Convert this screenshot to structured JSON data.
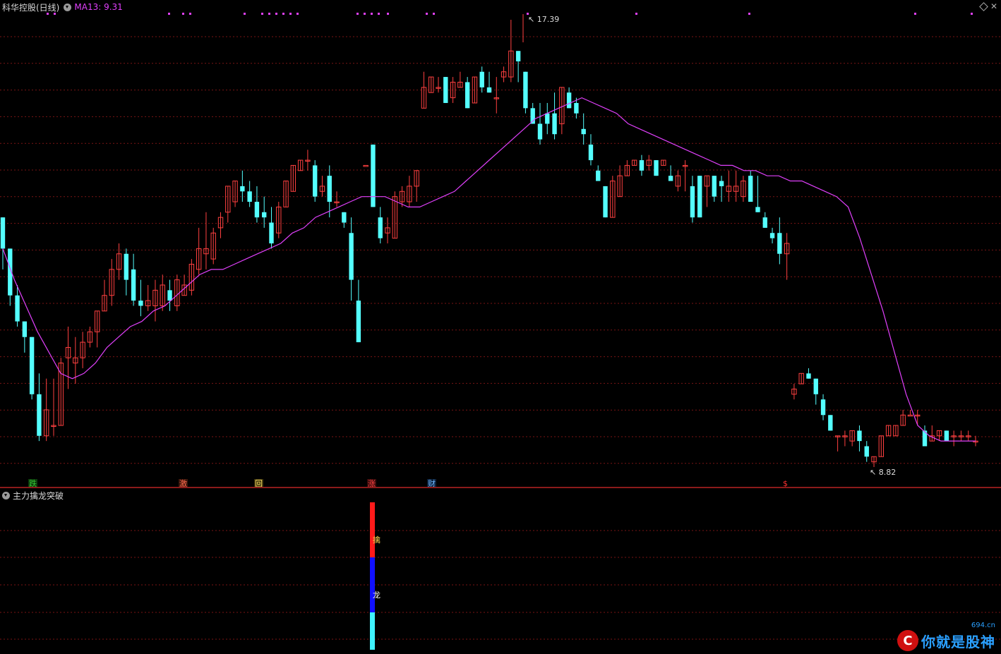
{
  "header": {
    "title": "科华控股(日线)",
    "ma_label": "MA13: 9.31"
  },
  "price_labels": {
    "high": "17.39",
    "low": "8.82"
  },
  "markers": [
    {
      "text": "跌",
      "color": "#35c535",
      "bg": "#0b3a0b"
    },
    {
      "text": "激",
      "color": "#ff6a4d",
      "bg": "#3a150b"
    },
    {
      "text": "回",
      "color": "#ffe066",
      "bg": "#3a320b"
    },
    {
      "text": "涨",
      "color": "#ff4444",
      "bg": "#3a0b0b"
    },
    {
      "text": "财",
      "color": "#6fb7ff",
      "bg": "#0b203a"
    },
    {
      "text": "$",
      "color": "#ff3030",
      "bg": "#000000"
    }
  ],
  "indicator": {
    "title": "主力擒龙突破",
    "bar_labels": [
      "擒",
      "龙"
    ]
  },
  "watermark": {
    "logo": "C",
    "text": "你就是股神",
    "site": "694.cn"
  },
  "colors": {
    "up": "#ff4040",
    "down": "#54ffff",
    "ma": "#e040fb",
    "grid": "#7a1414",
    "dot": "#e040fb"
  },
  "chart_data": {
    "type": "candlestick",
    "title": "科华控股(日线)",
    "ma_period": 13,
    "ma_last": 9.31,
    "y_high": 17.39,
    "y_low": 8.82,
    "candles": [
      [
        13.6,
        13.6,
        12.6,
        13.0
      ],
      [
        13.0,
        13.0,
        11.9,
        12.1
      ],
      [
        12.1,
        12.3,
        11.5,
        11.6
      ],
      [
        11.6,
        11.6,
        11.0,
        11.3
      ],
      [
        11.3,
        11.2,
        10.1,
        10.2
      ],
      [
        10.2,
        10.6,
        9.3,
        9.4
      ],
      [
        9.4,
        10.5,
        9.3,
        9.9
      ],
      [
        9.6,
        10.5,
        9.4,
        9.6
      ],
      [
        9.6,
        10.9,
        9.6,
        10.8
      ],
      [
        10.9,
        11.5,
        10.3,
        11.1
      ],
      [
        10.8,
        11.3,
        10.4,
        10.9
      ],
      [
        10.9,
        11.4,
        10.7,
        11.2
      ],
      [
        11.2,
        11.5,
        11.1,
        11.4
      ],
      [
        11.4,
        11.8,
        11.1,
        11.8
      ],
      [
        11.8,
        12.4,
        11.8,
        12.1
      ],
      [
        12.1,
        12.8,
        11.9,
        12.6
      ],
      [
        12.6,
        13.1,
        12.4,
        12.9
      ],
      [
        12.9,
        13.0,
        12.1,
        12.4
      ],
      [
        12.6,
        12.9,
        11.9,
        12.0
      ],
      [
        12.0,
        12.4,
        11.7,
        11.9
      ],
      [
        11.9,
        12.3,
        11.8,
        12.0
      ],
      [
        11.9,
        12.4,
        11.6,
        12.2
      ],
      [
        11.9,
        12.5,
        11.8,
        12.3
      ],
      [
        12.2,
        12.4,
        11.8,
        12.0
      ],
      [
        11.9,
        12.5,
        11.8,
        12.4
      ],
      [
        12.1,
        12.5,
        12.1,
        12.3
      ],
      [
        12.2,
        12.8,
        12.1,
        12.7
      ],
      [
        12.6,
        13.4,
        12.5,
        13.0
      ],
      [
        12.9,
        13.7,
        12.6,
        13.0
      ],
      [
        12.8,
        13.4,
        12.7,
        13.3
      ],
      [
        13.4,
        13.7,
        13.2,
        13.6
      ],
      [
        13.7,
        14.1,
        13.5,
        14.2
      ],
      [
        13.9,
        14.3,
        13.8,
        14.3
      ],
      [
        14.2,
        14.5,
        13.9,
        14.1
      ],
      [
        14.1,
        14.3,
        13.8,
        13.9
      ],
      [
        13.9,
        14.2,
        13.5,
        13.6
      ],
      [
        13.7,
        14.0,
        13.4,
        13.6
      ],
      [
        13.5,
        13.8,
        13.0,
        13.1
      ],
      [
        13.3,
        13.9,
        13.2,
        13.8
      ],
      [
        13.8,
        14.2,
        13.8,
        14.3
      ],
      [
        14.1,
        14.6,
        14.1,
        14.6
      ],
      [
        14.5,
        14.7,
        14.5,
        14.7
      ],
      [
        14.7,
        14.9,
        14.5,
        14.7
      ],
      [
        14.6,
        14.7,
        13.9,
        14.0
      ],
      [
        14.1,
        14.4,
        14.0,
        14.2
      ],
      [
        14.4,
        14.6,
        13.6,
        13.9
      ],
      [
        13.9,
        14.1,
        13.8,
        13.9
      ],
      [
        13.7,
        13.7,
        13.4,
        13.5
      ],
      [
        13.3,
        13.6,
        12.0,
        12.4
      ],
      [
        12.0,
        12.4,
        11.2,
        11.2
      ],
      [
        14.6,
        14.6,
        14.6,
        14.6
      ],
      [
        15.0,
        15.0,
        13.8,
        13.8
      ],
      [
        13.6,
        13.8,
        13.1,
        13.2
      ],
      [
        13.3,
        13.6,
        13.1,
        13.4
      ],
      [
        13.2,
        14.1,
        13.4,
        14.0
      ],
      [
        13.9,
        14.2,
        13.8,
        14.1
      ],
      [
        13.9,
        14.4,
        13.8,
        14.2
      ],
      [
        14.2,
        14.4,
        13.9,
        14.5
      ],
      [
        15.7,
        16.4,
        15.7,
        16.1
      ],
      [
        16.0,
        16.3,
        16.0,
        16.3
      ],
      [
        16.1,
        16.3,
        16.0,
        16.1
      ],
      [
        16.3,
        16.3,
        15.8,
        15.8
      ],
      [
        15.9,
        16.3,
        15.8,
        16.2
      ],
      [
        16.1,
        16.4,
        16.1,
        16.2
      ],
      [
        16.2,
        16.3,
        15.7,
        15.7
      ],
      [
        15.8,
        16.1,
        15.9,
        16.3
      ],
      [
        16.4,
        16.5,
        16.0,
        16.1
      ],
      [
        16.1,
        16.4,
        16.0,
        16.0
      ],
      [
        15.9,
        16.3,
        15.6,
        15.9
      ],
      [
        16.3,
        16.5,
        16.2,
        16.4
      ],
      [
        16.3,
        17.4,
        16.2,
        16.8
      ],
      [
        16.8,
        16.5,
        16.2,
        16.6
      ],
      [
        16.4,
        16.4,
        15.6,
        15.7
      ],
      [
        15.7,
        15.8,
        15.4,
        15.4
      ],
      [
        15.4,
        15.8,
        15.0,
        15.1
      ],
      [
        15.6,
        15.8,
        15.2,
        15.4
      ],
      [
        15.6,
        16.0,
        15.1,
        15.2
      ],
      [
        15.4,
        16.0,
        15.2,
        16.1
      ],
      [
        16.0,
        16.1,
        15.7,
        15.7
      ],
      [
        15.8,
        15.9,
        15.5,
        15.6
      ],
      [
        15.3,
        15.6,
        15.0,
        15.2
      ],
      [
        15.0,
        15.2,
        14.6,
        14.7
      ],
      [
        14.5,
        14.6,
        14.3,
        14.3
      ],
      [
        14.2,
        14.2,
        13.6,
        13.6
      ],
      [
        13.6,
        14.4,
        13.6,
        14.3
      ],
      [
        14.0,
        14.6,
        14.0,
        14.4
      ],
      [
        14.4,
        14.7,
        14.4,
        14.6
      ],
      [
        14.6,
        14.7,
        14.6,
        14.7
      ],
      [
        14.7,
        14.8,
        14.4,
        14.5
      ],
      [
        14.6,
        14.8,
        14.5,
        14.7
      ],
      [
        14.7,
        14.7,
        14.4,
        14.4
      ],
      [
        14.6,
        14.7,
        14.6,
        14.7
      ],
      [
        14.4,
        14.6,
        14.3,
        14.3
      ],
      [
        14.2,
        14.5,
        14.1,
        14.4
      ],
      [
        14.6,
        14.7,
        14.1,
        14.6
      ],
      [
        14.2,
        14.4,
        13.5,
        13.6
      ],
      [
        14.4,
        14.4,
        13.6,
        13.6
      ],
      [
        14.2,
        14.4,
        13.8,
        14.4
      ],
      [
        14.4,
        14.4,
        13.9,
        14.0
      ],
      [
        14.3,
        14.4,
        13.9,
        14.2
      ],
      [
        14.1,
        14.5,
        13.9,
        14.2
      ],
      [
        14.1,
        14.5,
        13.9,
        14.2
      ],
      [
        14.0,
        14.4,
        13.9,
        14.3
      ],
      [
        14.4,
        14.5,
        13.9,
        13.9
      ],
      [
        13.8,
        14.4,
        13.7,
        13.7
      ],
      [
        13.6,
        13.7,
        13.4,
        13.4
      ],
      [
        13.3,
        13.4,
        13.1,
        13.2
      ],
      [
        13.3,
        13.6,
        12.7,
        12.9
      ],
      [
        12.9,
        13.3,
        12.4,
        13.1
      ],
      [
        10.2,
        10.4,
        10.1,
        10.3
      ],
      [
        10.4,
        10.6,
        10.4,
        10.6
      ],
      [
        10.6,
        10.7,
        10.5,
        10.5
      ],
      [
        10.5,
        10.4,
        10.0,
        10.2
      ],
      [
        10.1,
        10.2,
        9.7,
        9.8
      ],
      [
        9.8,
        9.8,
        9.5,
        9.5
      ],
      [
        9.4,
        9.4,
        9.1,
        9.4
      ],
      [
        9.4,
        9.5,
        9.2,
        9.4
      ],
      [
        9.3,
        9.5,
        9.2,
        9.5
      ],
      [
        9.5,
        9.6,
        9.1,
        9.3
      ],
      [
        9.2,
        9.3,
        8.9,
        9.0
      ],
      [
        8.9,
        9.0,
        8.8,
        9.0
      ],
      [
        9.0,
        9.4,
        9.0,
        9.4
      ],
      [
        9.4,
        9.6,
        9.4,
        9.6
      ],
      [
        9.4,
        9.6,
        9.4,
        9.6
      ],
      [
        9.6,
        9.9,
        9.6,
        9.8
      ],
      [
        9.8,
        9.9,
        9.8,
        9.8
      ],
      [
        9.8,
        9.9,
        9.6,
        9.8
      ],
      [
        9.5,
        9.6,
        9.2,
        9.2
      ],
      [
        9.3,
        9.6,
        9.3,
        9.4
      ],
      [
        9.4,
        9.5,
        9.3,
        9.5
      ],
      [
        9.5,
        9.5,
        9.3,
        9.3
      ],
      [
        9.4,
        9.5,
        9.2,
        9.4
      ],
      [
        9.4,
        9.5,
        9.3,
        9.4
      ],
      [
        9.4,
        9.5,
        9.3,
        9.4
      ],
      [
        9.3,
        9.4,
        9.2,
        9.3
      ]
    ],
    "ma13": [
      13.0,
      12.4,
      11.9,
      11.4,
      11.0,
      10.6,
      10.5,
      10.6,
      10.8,
      11.1,
      11.3,
      11.5,
      11.6,
      11.8,
      11.9,
      12.1,
      12.3,
      12.5,
      12.6,
      12.6,
      12.7,
      12.8,
      12.9,
      13.0,
      13.1,
      13.3,
      13.4,
      13.6,
      13.7,
      13.8,
      13.9,
      14.0,
      14.0,
      14.0,
      13.9,
      13.8,
      13.8,
      13.9,
      14.0,
      14.1,
      14.3,
      14.5,
      14.7,
      14.9,
      15.1,
      15.3,
      15.5,
      15.6,
      15.7,
      15.8,
      15.9,
      15.8,
      15.7,
      15.6,
      15.4,
      15.3,
      15.2,
      15.1,
      15.0,
      14.9,
      14.8,
      14.7,
      14.6,
      14.6,
      14.5,
      14.5,
      14.4,
      14.4,
      14.3,
      14.3,
      14.2,
      14.1,
      14.0,
      13.8,
      13.2,
      12.5,
      11.8,
      11.0,
      10.2,
      9.6,
      9.4,
      9.3,
      9.3,
      9.3,
      9.3
    ]
  }
}
